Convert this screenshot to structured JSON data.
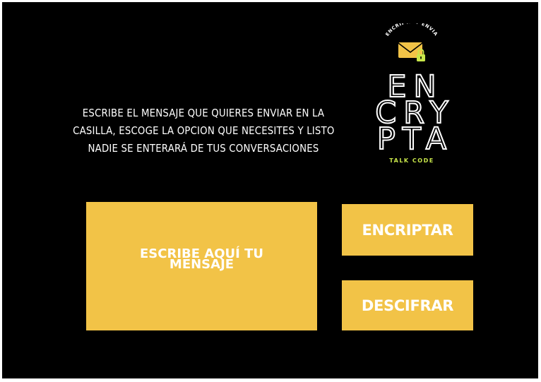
{
  "instructions": {
    "line1": "ESCRIBE EL MENSAJE QUE QUIERES ENVIAR EN LA",
    "line2": "CASILLA, ESCOGE LA OPCION QUE NECESITES Y LISTO",
    "line3": "NADIE SE ENTERARÁ DE TUS CONVERSACIONES"
  },
  "logo": {
    "arc_text": "ENCRIPTA Y ENVIA",
    "line1": "EN",
    "line2": "CRY",
    "line3": "PTA",
    "tagline": "TALK CODE",
    "icon": "envelope-lock-icon"
  },
  "message_input": {
    "placeholder_line1": "ESCRIBE AQUÍ TU",
    "placeholder_line2": "MENSAJE"
  },
  "actions": {
    "encrypt_label": "ENCRIPTAR",
    "decrypt_label": "DESCIFRAR"
  },
  "colors": {
    "background": "#000000",
    "accent": "#f2c347",
    "tagline": "#c8e64a"
  }
}
